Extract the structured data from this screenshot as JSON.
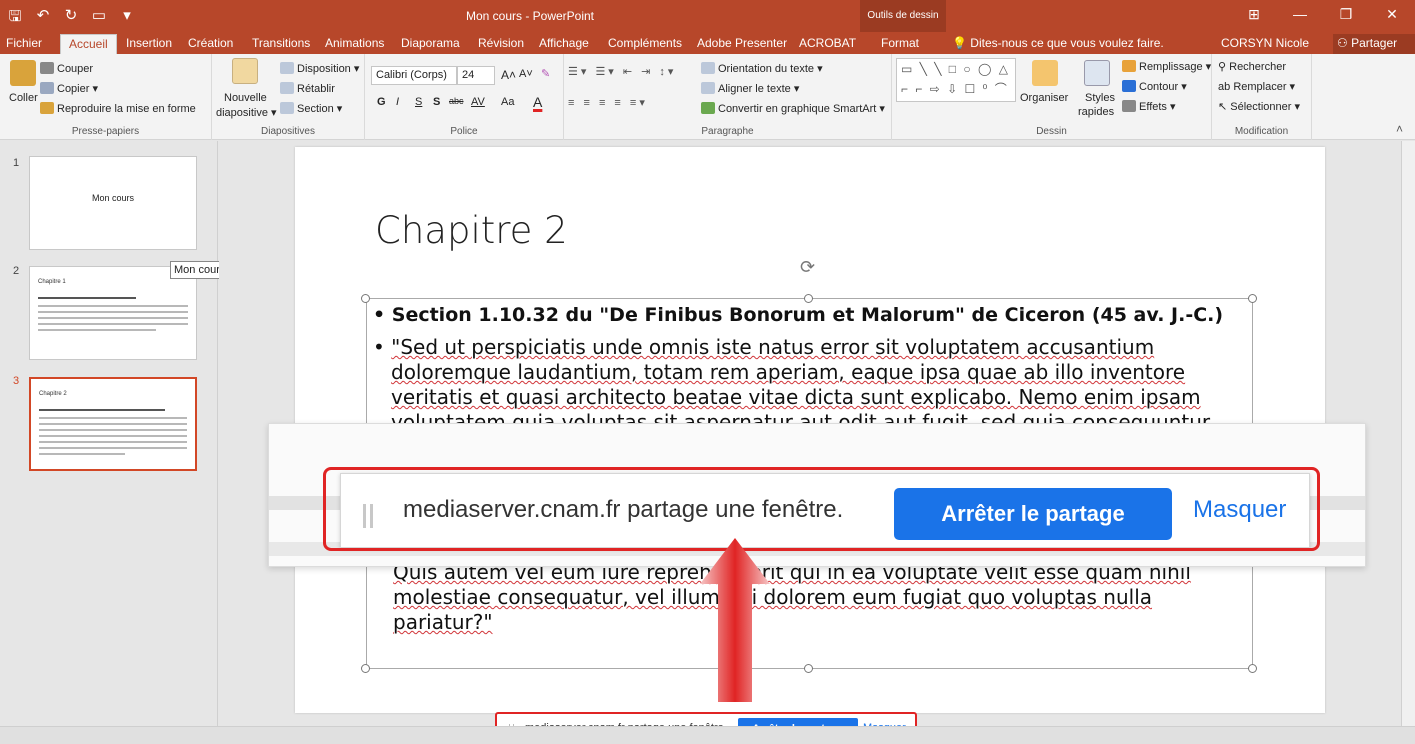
{
  "window": {
    "title": "Mon cours - PowerPoint",
    "contextual_tools": "Outils de dessin",
    "accent": "#b7472a"
  },
  "tabs": [
    {
      "label": "Fichier",
      "active": false
    },
    {
      "label": "Accueil",
      "active": true
    },
    {
      "label": "Insertion",
      "active": false
    },
    {
      "label": "Création",
      "active": false
    },
    {
      "label": "Transitions",
      "active": false
    },
    {
      "label": "Animations",
      "active": false
    },
    {
      "label": "Diaporama",
      "active": false
    },
    {
      "label": "Révision",
      "active": false
    },
    {
      "label": "Affichage",
      "active": false
    },
    {
      "label": "Compléments",
      "active": false
    },
    {
      "label": "Adobe Presenter",
      "active": false
    },
    {
      "label": "ACROBAT",
      "active": false
    },
    {
      "label": "Format",
      "active": false
    }
  ],
  "tell_me": "Dites-nous ce que vous voulez faire.",
  "user": "CORSYN Nicole",
  "share_label": "Partager",
  "ribbon": {
    "clipboard": {
      "label": "Presse-papiers",
      "paste": "Coller",
      "cut": "Couper",
      "copy": "Copier",
      "format_painter": "Reproduire la mise en forme"
    },
    "slides": {
      "label": "Diapositives",
      "new_slide_1": "Nouvelle",
      "new_slide_2": "diapositive",
      "layout": "Disposition",
      "reset": "Rétablir",
      "section": "Section"
    },
    "font": {
      "label": "Police",
      "font_name": "Calibri (Corps)",
      "font_size": "24",
      "bold": "G",
      "italic": "I",
      "underline": "S",
      "shadow": "S",
      "strike": "abc",
      "spacing": "AV",
      "case": "Aa",
      "color": "A"
    },
    "paragraph": {
      "label": "Paragraphe",
      "text_direction": "Orientation du texte",
      "align_text": "Aligner le texte",
      "smartart": "Convertir en graphique SmartArt"
    },
    "drawing": {
      "label": "Dessin",
      "shapes": "▭ ╲ ╲ □ ○ ◯ △ ⌐ ⌐ ⇨ ⇩ ☐ ⁰ ⌒ ⌒ { } ☆",
      "arrange": "Organiser",
      "quick_styles_1": "Styles",
      "quick_styles_2": "rapides",
      "fill": "Remplissage",
      "outline": "Contour",
      "effects": "Effets"
    },
    "editing": {
      "label": "Modification",
      "find": "Rechercher",
      "replace": "Remplacer",
      "select": "Sélectionner"
    }
  },
  "thumbnails": [
    {
      "num": "1",
      "title": "Mon cours",
      "selected": false
    },
    {
      "num": "2",
      "title": "Chapitre 1",
      "selected": false
    },
    {
      "num": "3",
      "title": "Chapitre 2",
      "selected": true
    }
  ],
  "tooltip": "Mon cours",
  "slide": {
    "title": "Chapitre 2",
    "bullet1": "Section 1.10.32 du \"De Finibus Bonorum et Malorum\" de Ciceron (45 av. J.-C.)",
    "bullet2": "\"Sed ut perspiciatis unde omnis iste natus error sit voluptatem accusantium doloremque laudantium, totam rem aperiam, eaque ipsa quae ab illo inventore veritatis et quasi architecto beatae vitae dicta sunt explicabo. Nemo enim ipsam voluptatem quia voluptas sit aspernatur aut odit aut fugit, sed quia consequuntur",
    "bullet_end": "Quis autem vel eum iure reprehenderit qui in ea voluptate velit esse quam nihil molestiae consequatur, vel illum qui dolorem eum fugiat quo voluptas nulla pariatur?\""
  },
  "share_banner": {
    "message": "mediaserver.cnam.fr partage une fenêtre.",
    "stop": "Arrêter le partage",
    "hide": "Masquer",
    "button_color": "#1a73e8",
    "highlight_color": "#e02424"
  }
}
